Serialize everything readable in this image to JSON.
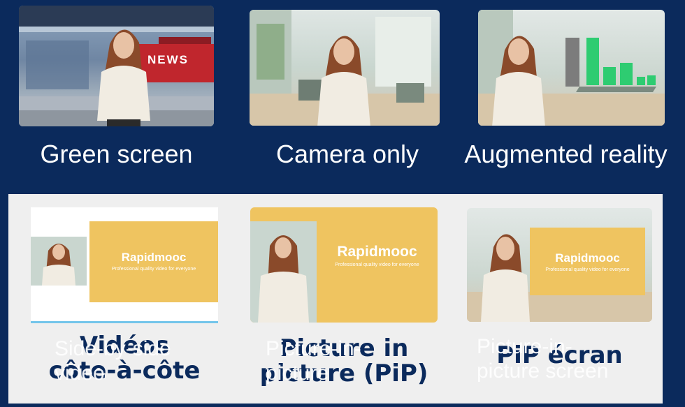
{
  "top_row": [
    {
      "label": "Green screen",
      "badge": "NEWS"
    },
    {
      "label": "Camera only"
    },
    {
      "label": "Augmented reality"
    }
  ],
  "bottom_row": [
    {
      "fr_line1": "Vidéos",
      "fr_line2": "côte-à-côte",
      "en_line1": "Side-by-side",
      "en_line2": "video",
      "logo": "Rapidmooc",
      "tagline": "Professional quality video for everyone"
    },
    {
      "fr_line1": "Picture in",
      "fr_line2": "picture (PiP)",
      "en_line1": "Picture-in-",
      "en_line2": "picture",
      "logo": "Rapidmooc",
      "tagline": "Professional quality video for everyone"
    },
    {
      "fr_line1": "PiP écran",
      "fr_line2": "",
      "en_line1": "Picture-in-",
      "en_line2": "picture screen",
      "logo": "Rapidmooc",
      "tagline": "Professional quality video for everyone"
    }
  ],
  "colors": {
    "background": "#0b2a5c",
    "accent_yellow": "#efc460",
    "underline": "#74c5ea",
    "news_red": "#c0262d",
    "chart_green": "#2ecc71"
  }
}
